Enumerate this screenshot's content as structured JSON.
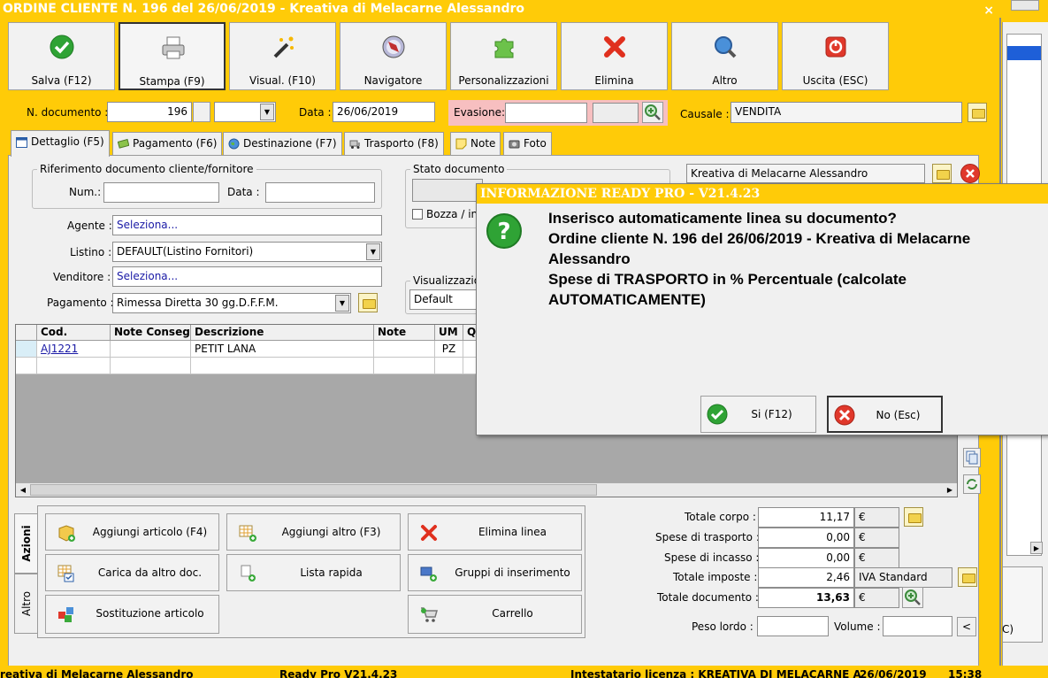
{
  "window": {
    "title": "ORDINE CLIENTE N. 196 del 26/06/2019 - Kreativa di Melacarne Alessandro",
    "close": "×"
  },
  "toolbar": [
    {
      "label": "Salva (F12)",
      "icon": "check-icon"
    },
    {
      "label": "Stampa (F9)",
      "icon": "printer-icon"
    },
    {
      "label": "Visual. (F10)",
      "icon": "magic-wand-icon"
    },
    {
      "label": "Navigatore",
      "icon": "compass-icon"
    },
    {
      "label": "Personalizzazioni",
      "icon": "puzzle-icon"
    },
    {
      "label": "Elimina",
      "icon": "delete-x-icon"
    },
    {
      "label": "Altro",
      "icon": "search-globe-icon"
    },
    {
      "label": "Uscita (ESC)",
      "icon": "exit-icon"
    }
  ],
  "header": {
    "num_doc_label": "N. documento :",
    "num_doc": "196",
    "data_label": "Data :",
    "data": "26/06/2019",
    "evasione_label": "Evasione:",
    "evasione": "",
    "causale_label": "Causale :",
    "causale": "VENDITA"
  },
  "tabs": [
    {
      "label": "Dettaglio (F5)"
    },
    {
      "label": "Pagamento (F6)"
    },
    {
      "label": "Destinazione (F7)"
    },
    {
      "label": "Trasporto (F8)"
    },
    {
      "label": "Note"
    },
    {
      "label": "Foto"
    }
  ],
  "riferimento": {
    "title": "Riferimento documento cliente/fornitore",
    "num_label": "Num.:",
    "num": "",
    "data_label": "Data :",
    "data": ""
  },
  "stato": {
    "title": "Stato documento",
    "bozza": "Bozza / in"
  },
  "cliente": "Kreativa di Melacarne Alessandro",
  "form": {
    "agente_label": "Agente :",
    "agente": "Seleziona...",
    "listino_label": "Listino :",
    "listino": "DEFAULT(Listino Fornitori)",
    "venditore_label": "Venditore :",
    "venditore": "Seleziona...",
    "pagamento_label": "Pagamento :",
    "pagamento": "Rimessa Diretta 30 gg.D.F.F.M.",
    "visualizzazione_label": "Visualizzazio",
    "visualizzazione": "Default"
  },
  "grid": {
    "columns": [
      "Cod.",
      "Note Conseg...",
      "Descrizione",
      "Note",
      "UM",
      "Q"
    ],
    "rows": [
      {
        "cod": "AJ1221",
        "note_conseg": "",
        "descrizione": "PETIT LANA",
        "note": "",
        "um": "PZ"
      }
    ]
  },
  "vtabs": [
    "Azioni",
    "Altro"
  ],
  "actions": [
    {
      "label": "Aggiungi articolo (F4)",
      "icon": "box-add-icon"
    },
    {
      "label": "Aggiungi altro (F3)",
      "icon": "grid-add-icon"
    },
    {
      "label": "Elimina linea",
      "icon": "delete-x-icon"
    },
    {
      "label": "Carica da altro doc.",
      "icon": "doc-load-icon"
    },
    {
      "label": "Lista rapida",
      "icon": "quick-list-icon"
    },
    {
      "label": "Gruppi di inserimento",
      "icon": "group-add-icon"
    },
    {
      "label": "Sostituzione articolo",
      "icon": "replace-icon"
    },
    {
      "label": "Carrello",
      "icon": "cart-icon"
    }
  ],
  "totals": {
    "corpo_label": "Totale corpo :",
    "corpo": "11,17",
    "trasporto_label": "Spese di trasporto :",
    "trasporto": "0,00",
    "incasso_label": "Spese di incasso :",
    "incasso": "0,00",
    "imposte_label": "Totale imposte :",
    "imposte": "2,46",
    "iva": "IVA Standard",
    "documento_label": "Totale documento :",
    "documento": "13,63",
    "currency": "€",
    "peso_label": "Peso lordo :",
    "volume_label": "Volume :",
    "arrow": "<"
  },
  "dialog": {
    "title": "INFORMAZIONE READY PRO - V21.4.23",
    "message": "Inserisco automaticamente linea su documento?\nOrdine cliente N. 196 del 26/06/2019 - Kreativa di Melacarne\nAlessandro\nSpese di TRASPORTO in % Percentuale (calcolate\nAUTOMATICAMENTE)",
    "yes": "Si (F12)",
    "no": "No (Esc)"
  },
  "statusbar": {
    "company": "reativa di Melacarne Alessandro",
    "version": "Ready Pro V21.4.23",
    "license": "Intestatario licenza : KREATIVA DI MELACARNE A",
    "date": "26/06/2019",
    "time": "15:38"
  },
  "bg_window": {
    "fragment": "C)"
  },
  "colors": {
    "accent": "#FFCB08",
    "link": "#1A1AA6"
  }
}
